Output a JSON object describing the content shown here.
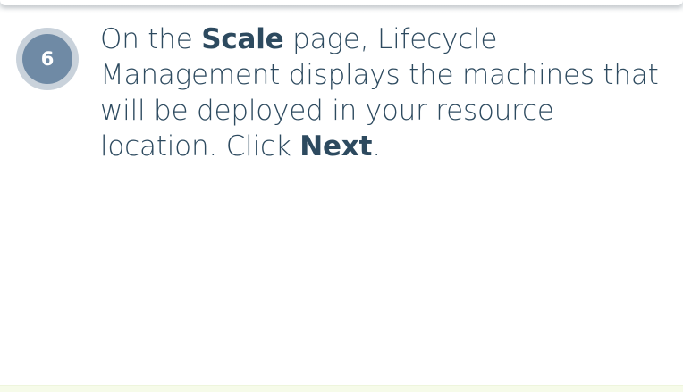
{
  "step": {
    "number": "6",
    "text_parts": {
      "p1": "On the ",
      "b1": "Scale",
      "p2": " page, Lifecycle Management displays the machines that will be deployed in your resource location. Click ",
      "b2": "Next",
      "p3": "."
    }
  },
  "colors": {
    "badge_outer": "#c9d2db",
    "badge_inner": "#6f8aa5",
    "text": "#2d4a5f",
    "bottom_band": "#f6fbe9"
  }
}
